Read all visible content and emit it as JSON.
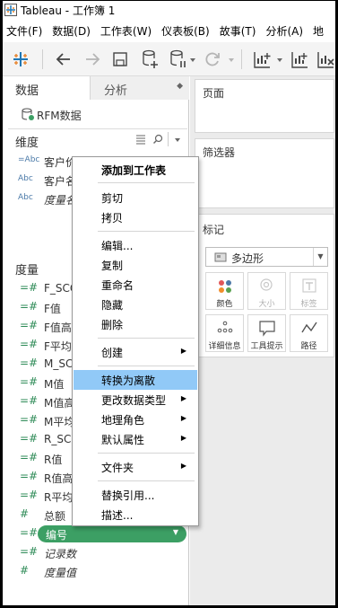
{
  "window": {
    "title": "Tableau - 工作簿 1"
  },
  "menubar": {
    "items": [
      {
        "label": "文件(F)"
      },
      {
        "label": "数据(D)"
      },
      {
        "label": "工作表(W)"
      },
      {
        "label": "仪表板(B)"
      },
      {
        "label": "故事(T)"
      },
      {
        "label": "分析(A)"
      },
      {
        "label": "地"
      }
    ]
  },
  "toolbar": {
    "icons": [
      "tableau-logo-icon",
      "back-icon",
      "forward-icon",
      "save-icon",
      "new-datasource-icon",
      "pause-update-icon",
      "refresh-icon",
      "new-worksheet-icon",
      "swap-icon"
    ]
  },
  "left_panel": {
    "tabs": {
      "data": "数据",
      "analysis": "分析"
    },
    "datasource": "RFM数据",
    "dimensions": {
      "header": "维度",
      "fields": [
        {
          "type": "=Abc",
          "name": "客户价值"
        },
        {
          "type": "Abc",
          "name": "客户名称"
        },
        {
          "type": "Abc",
          "name": "度量名称",
          "italic": true
        }
      ]
    },
    "measures": {
      "header": "度量",
      "fields": [
        {
          "type": "=#",
          "name": "F_SCORE"
        },
        {
          "type": "=#",
          "name": "F值"
        },
        {
          "type": "=#",
          "name": "F值高低"
        },
        {
          "type": "=#",
          "name": "F平均值"
        },
        {
          "type": "=#",
          "name": "M_SCORE"
        },
        {
          "type": "=#",
          "name": "M值"
        },
        {
          "type": "=#",
          "name": "M值高低"
        },
        {
          "type": "=#",
          "name": "M平均值"
        },
        {
          "type": "=#",
          "name": "R_SCORE"
        },
        {
          "type": "=#",
          "name": "R值"
        },
        {
          "type": "=#",
          "name": "R值高低"
        },
        {
          "type": "=#",
          "name": "R平均值"
        },
        {
          "type": "#",
          "name": "总额"
        }
      ],
      "selected": {
        "type": "=#",
        "name": "编号"
      },
      "after": [
        {
          "type": "=#",
          "name": "记录数",
          "italic": true
        },
        {
          "type": "#",
          "name": "度量值",
          "italic": true
        }
      ]
    }
  },
  "right_area": {
    "pages": "页面",
    "filters": "筛选器",
    "marks": {
      "title": "标记",
      "mark_type": "多边形",
      "buttons": [
        {
          "label": "颜色",
          "enabled": true
        },
        {
          "label": "大小",
          "enabled": false
        },
        {
          "label": "标签",
          "enabled": false
        },
        {
          "label": "详细信息",
          "enabled": true
        },
        {
          "label": "工具提示",
          "enabled": true
        },
        {
          "label": "路径",
          "enabled": true
        }
      ]
    }
  },
  "context_menu": {
    "items": [
      {
        "label": "添加到工作表",
        "bold": true
      },
      {
        "label": "剪切"
      },
      {
        "label": "拷贝"
      },
      {
        "label": "编辑..."
      },
      {
        "label": "复制"
      },
      {
        "label": "重命名"
      },
      {
        "label": "隐藏"
      },
      {
        "label": "删除"
      },
      {
        "label": "创建",
        "submenu": true
      },
      {
        "label": "转换为离散",
        "highlighted": true
      },
      {
        "label": "更改数据类型",
        "submenu": true
      },
      {
        "label": "地理角色",
        "submenu": true
      },
      {
        "label": "默认属性",
        "submenu": true
      },
      {
        "label": "文件夹",
        "submenu": true
      },
      {
        "label": "替换引用..."
      },
      {
        "label": "描述..."
      }
    ]
  },
  "colors": {
    "pill_green": "#3c9f64",
    "highlight_blue": "#91c9f7",
    "dimension_blue": "#4b7aa8",
    "measure_green": "#2e8b57"
  }
}
